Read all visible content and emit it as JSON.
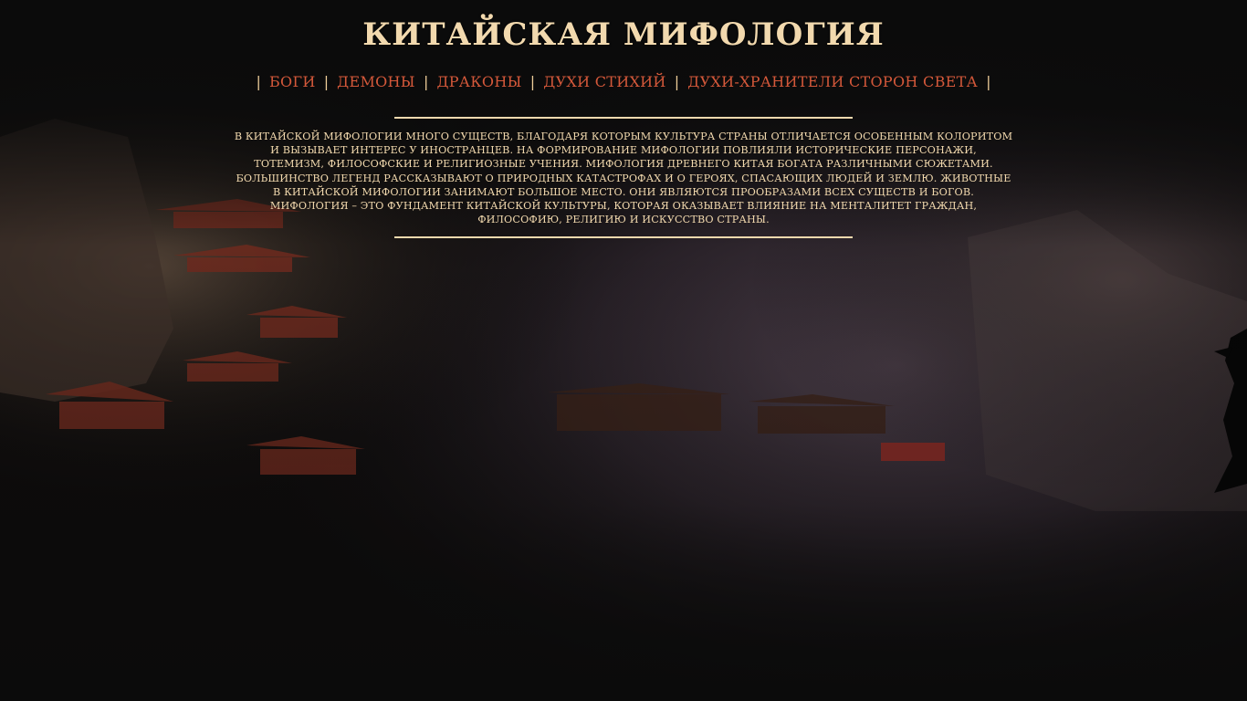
{
  "header": {
    "title": "Китайская мифология"
  },
  "nav": {
    "separator": "|",
    "items": [
      {
        "label": "Боги"
      },
      {
        "label": "Демоны"
      },
      {
        "label": "Драконы"
      },
      {
        "label": "Духи стихий"
      },
      {
        "label": "Духи-хранители сторон света"
      }
    ]
  },
  "intro": {
    "text": "В китайской мифологии много существ, благодаря которым культура страны отличается особенным колоритом и вызывает интерес у иностранцев. На формирование мифологии повлияли исторические персонажи, тотемизм, философские и религиозные учения. Мифология древнего Китая богата различными сюжетами. Большинство легенд рассказывают о природных катастрофах и о героях, спасающих людей и землю. Животные в китайской мифологии занимают большое место. Они являются прообразами всех существ и богов. Мифология – это фундамент китайской культуры, которая оказывает влияние на менталитет граждан, философию, религию и искусство страны."
  },
  "colors": {
    "background": "#0b0b0b",
    "title": "#f2d9ae",
    "nav_link": "#d4583a",
    "text": "#f2d9ae",
    "temple_roof": "#7a2418"
  },
  "background_image": {
    "icon": "chinese-mountain-temple-illustration"
  }
}
